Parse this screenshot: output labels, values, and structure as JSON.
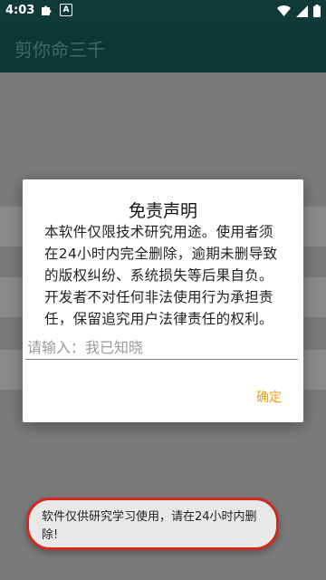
{
  "status_bar": {
    "time": "4:03",
    "icons": [
      "puzzle-icon",
      "a-notification-icon",
      "wifi-icon",
      "signal-icon",
      "battery-icon"
    ],
    "a_glyph": "A"
  },
  "app_bar": {
    "title": "剪你命三千"
  },
  "dialog": {
    "title": "免责声明",
    "body": "本软件仅限技术研究用途。使用者须在24小时内完全删除，逾期未删导致的版权纠纷、系统损失等后果自负。开发者不对任何非法使用行为承担责任，保留追究用户法律责任的权利。",
    "input_placeholder": "请输入：我已知晓",
    "input_value": "",
    "confirm_label": "确定",
    "accent_color": "#f39c12"
  },
  "toast": {
    "text": "软件仅供研究学习使用，请在24小时内删除!",
    "highlight_color": "#d7261e"
  },
  "colors": {
    "app_bar": "#0e3733",
    "scrim": "#7a7a7a"
  }
}
